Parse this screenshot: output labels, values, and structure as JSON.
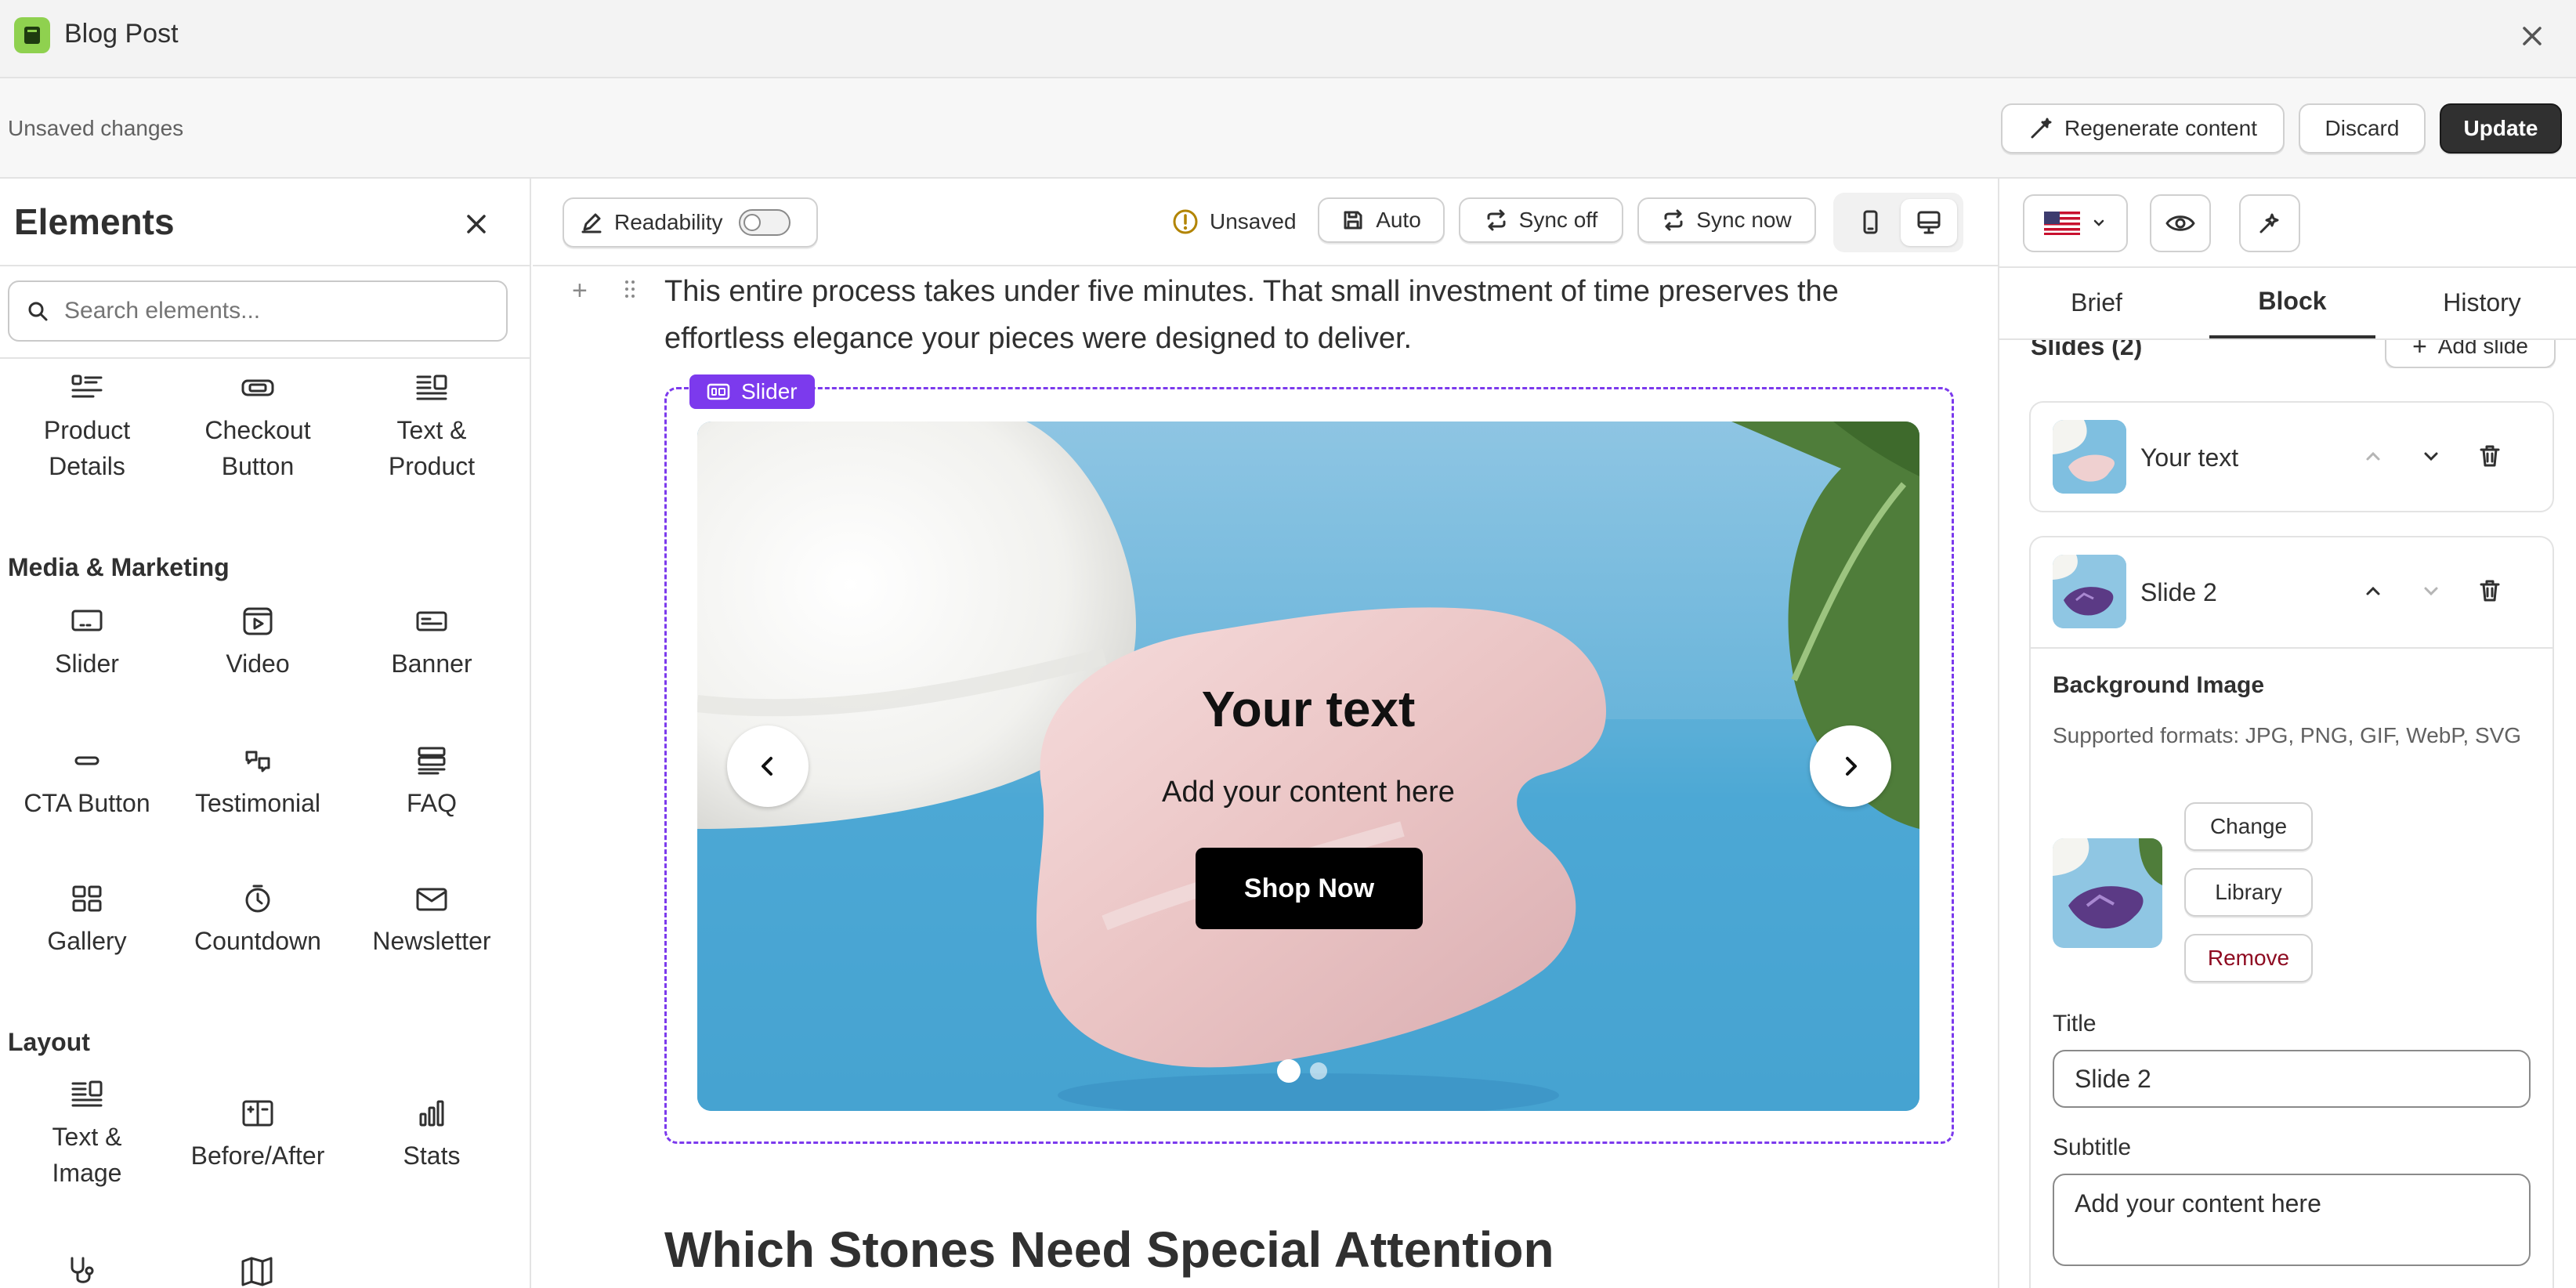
{
  "window": {
    "title": "Blog Post"
  },
  "subheader": {
    "status": "Unsaved changes",
    "regenerate_label": "Regenerate content",
    "discard_label": "Discard",
    "update_label": "Update"
  },
  "elements_panel": {
    "title": "Elements",
    "search_placeholder": "Search elements...",
    "row1": [
      {
        "label": "Product Details",
        "icon": "product-details-icon"
      },
      {
        "label": "Checkout Button",
        "icon": "checkout-button-icon"
      },
      {
        "label": "Text & Product",
        "icon": "text-product-icon"
      }
    ],
    "media_heading": "Media & Marketing",
    "media": [
      {
        "label": "Slider",
        "icon": "slider-icon"
      },
      {
        "label": "Video",
        "icon": "video-icon"
      },
      {
        "label": "Banner",
        "icon": "banner-icon"
      },
      {
        "label": "CTA Button",
        "icon": "cta-button-icon"
      },
      {
        "label": "Testimonial",
        "icon": "testimonial-icon"
      },
      {
        "label": "FAQ",
        "icon": "faq-icon"
      },
      {
        "label": "Gallery",
        "icon": "gallery-icon"
      },
      {
        "label": "Countdown",
        "icon": "countdown-icon"
      },
      {
        "label": "Newsletter",
        "icon": "newsletter-icon"
      }
    ],
    "layout_heading": "Layout",
    "layout": [
      {
        "label": "Text & Image",
        "icon": "text-image-icon"
      },
      {
        "label": "Before/After",
        "icon": "before-after-icon"
      },
      {
        "label": "Stats",
        "icon": "stats-icon"
      }
    ]
  },
  "editor_toolbar": {
    "readability_label": "Readability",
    "readability_on": false,
    "unsaved_label": "Unsaved",
    "auto_label": "Auto",
    "sync_off_label": "Sync off",
    "sync_now_label": "Sync now"
  },
  "content": {
    "paragraph": "This entire process takes under five minutes. That small investment of time preserves the effortless elegance your pieces were designed to deliver.",
    "slider_tag": "Slider",
    "slide_title": "Your text",
    "slide_subtitle": "Add your content here",
    "slide_button": "Shop Now",
    "heading": "Which Stones Need Special Attention",
    "dots_total": 2,
    "dots_active": 1
  },
  "right_panel": {
    "tabs": [
      "Brief",
      "Block",
      "History"
    ],
    "active_tab": "Block",
    "slides_heading": "Slides (2)",
    "add_slide_label": "Add slide",
    "slides": [
      {
        "name": "Your text"
      },
      {
        "name": "Slide 2"
      }
    ],
    "bg_image_label": "Background Image",
    "formats_text": "Supported formats: JPG, PNG, GIF, WebP, SVG",
    "change_label": "Change",
    "library_label": "Library",
    "remove_label": "Remove",
    "title_label": "Title",
    "title_value": "Slide 2",
    "subtitle_label": "Subtitle",
    "subtitle_value": "Add your content here"
  },
  "colors": {
    "accent": "#7c3aed",
    "danger": "#8e0b21",
    "primary_button": "#303030"
  }
}
